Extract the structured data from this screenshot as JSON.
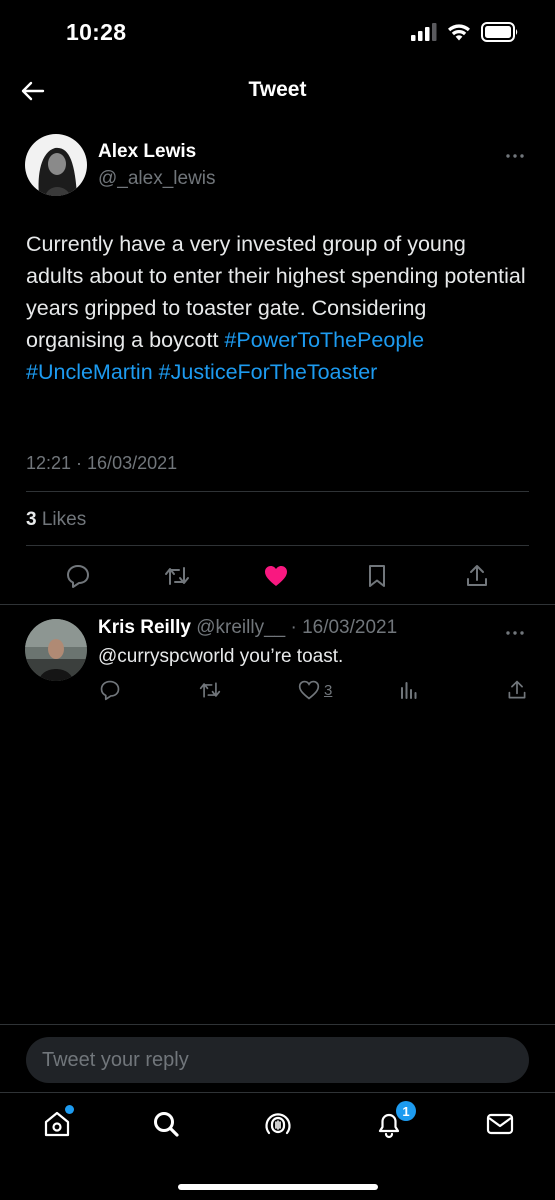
{
  "status_bar": {
    "time": "10:28",
    "icons": [
      "signal-icon",
      "wifi-icon",
      "battery-icon"
    ]
  },
  "header": {
    "title": "Tweet",
    "back_icon": "back-arrow-icon"
  },
  "tweet": {
    "author_name": "Alex Lewis",
    "author_handle": "@_alex_lewis",
    "text_plain": "Currently have a very invested group of young adults about to enter their highest spending potential years gripped to toaster gate. Considering organising a boycott",
    "hashtags": [
      "#PowerToThePeople",
      "#UncleMartin",
      "#JusticeForTheToaster"
    ],
    "timestamp": "12:21 · 16/03/2021",
    "likes_count": "3",
    "likes_label": "Likes",
    "liked": true,
    "actions": [
      "reply-icon",
      "retweet-icon",
      "like-icon",
      "bookmark-icon",
      "share-icon"
    ]
  },
  "reply": {
    "author_name": "Kris Reilly",
    "author_meta": "@kreilly__ · 16/03/2021",
    "text": "@curryspcworld you’re toast.",
    "like_count": "3",
    "actions": [
      "reply-icon",
      "retweet-icon",
      "like-icon",
      "views-icon",
      "share-icon"
    ]
  },
  "compose": {
    "placeholder": "Tweet your reply"
  },
  "tab_bar": {
    "tabs": [
      "home-icon",
      "search-icon",
      "spaces-icon",
      "notifications-icon",
      "messages-icon"
    ],
    "notification_badge": "1"
  },
  "colors": {
    "accent": "#1d9bf0",
    "like": "#f91880",
    "background": "#000000",
    "secondary_text": "#71767b"
  }
}
